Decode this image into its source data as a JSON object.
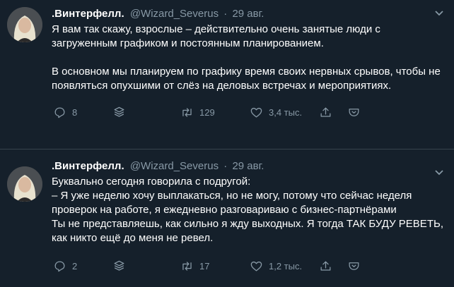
{
  "colors": {
    "background": "#15202b",
    "text": "#ffffff",
    "muted": "#8899a6",
    "divider": "#38444d"
  },
  "tweets": [
    {
      "author_name": ".Винтерфелл.",
      "handle": "@Wizard_Severus",
      "separator": "·",
      "date": "29 авг.",
      "paragraphs": [
        "Я вам так скажу, взрослые – действительно очень занятые люди с загруженным графиком и постоянным планированием.",
        "В основном мы планируем по графику время своих нервных срывов, чтобы не появляться опухшими от слёз на деловых встречах и мероприятиях."
      ],
      "replies": "8",
      "retweets": "129",
      "likes": "3,4 тыс.",
      "icons": [
        "reply-icon",
        "stack-icon",
        "retweet-icon",
        "like-icon",
        "share-icon",
        "bookmark-icon"
      ]
    },
    {
      "author_name": ".Винтерфелл.",
      "handle": "@Wizard_Severus",
      "separator": "·",
      "date": "29 авг.",
      "lines": [
        "Буквально сегодня говорила с подругой:",
        "– Я уже неделю хочу выплакаться, но не могу, потому что сейчас неделя проверок на работе, я ежедневно разговариваю с бизнес-партнёрами",
        "Ты не представляешь, как сильно я жду выходных. Я тогда ТАК БУДУ РЕВЕТЬ, как никто ещё до меня не ревел."
      ],
      "replies": "2",
      "retweets": "17",
      "likes": "1,2 тыс.",
      "icons": [
        "reply-icon",
        "stack-icon",
        "retweet-icon",
        "like-icon",
        "share-icon",
        "bookmark-icon"
      ]
    }
  ]
}
